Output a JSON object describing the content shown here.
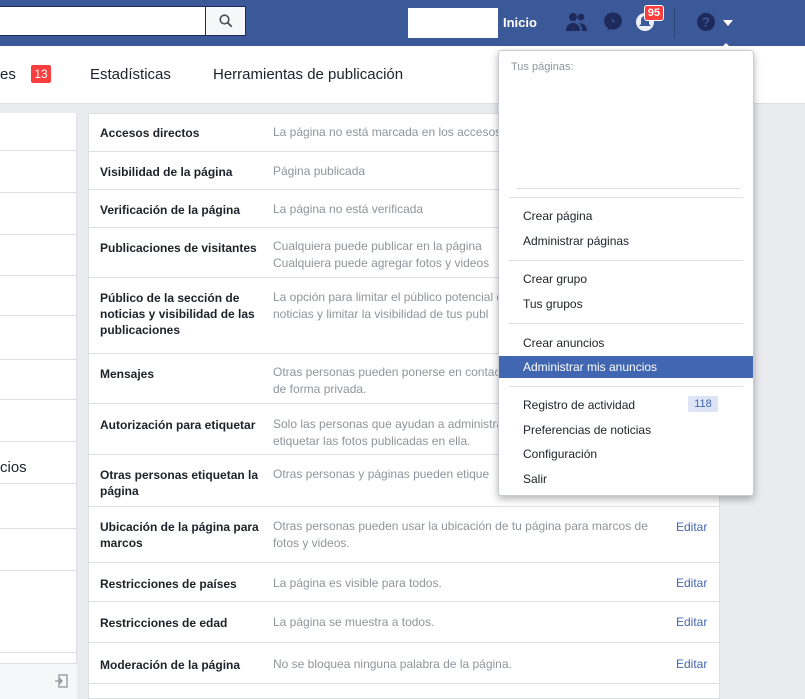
{
  "colors": {
    "topbar": "#3b5998",
    "link": "#4267b2",
    "badge": "#fa3e3e",
    "highlight": "#4267b2"
  },
  "topbar": {
    "inicio": "Inicio",
    "notifications_count": "95",
    "icons": [
      "search-icon",
      "friends-icon",
      "messenger-icon",
      "notifications-icon",
      "help-icon",
      "chevron-down-icon"
    ]
  },
  "tabs": {
    "partial_label": "es",
    "partial_badge": "13",
    "estadisticas": "Estadísticas",
    "herramientas": "Herramientas de publicación"
  },
  "sidebar": {
    "partial_text": "cios"
  },
  "settings": [
    {
      "label": "Accesos directos",
      "value": "La página no está marcada en los accesos",
      "edit": ""
    },
    {
      "label": "Visibilidad de la página",
      "value": "Página publicada",
      "edit": ""
    },
    {
      "label": "Verificación de la página",
      "value": "La página no está verificada",
      "edit": ""
    },
    {
      "label": "Publicaciones de visitantes",
      "value": "Cualquiera puede publicar en la página\nCualquiera puede agregar fotos y videos",
      "edit": ""
    },
    {
      "label": "Público de la sección de noticias y visibilidad de las publicaciones",
      "value": "La opción para limitar el público potencial de noticias y limitar la visibilidad de tus publ",
      "edit": ""
    },
    {
      "label": "Mensajes",
      "value": "Otras personas pueden ponerse en contacto de forma privada.",
      "edit": ""
    },
    {
      "label": "Autorización para etiquetar",
      "value": "Solo las personas que ayudan a administrar etiquetar las fotos publicadas en ella.",
      "edit": ""
    },
    {
      "label": "Otras personas etiquetan la página",
      "value": "Otras personas y páginas pueden etique",
      "edit": ""
    },
    {
      "label": "Ubicación de la página para marcos",
      "value": "Otras personas pueden usar la ubicación de tu página para marcos de fotos y videos.",
      "edit": "Editar"
    },
    {
      "label": "Restricciones de países",
      "value": "La página es visible para todos.",
      "edit": "Editar"
    },
    {
      "label": "Restricciones de edad",
      "value": "La página se muestra a todos.",
      "edit": "Editar"
    },
    {
      "label": "Moderación de la página",
      "value": "No se bloquea ninguna palabra de la página.",
      "edit": "Editar"
    }
  ],
  "dropdown": {
    "header": "Tus páginas:",
    "group1": [
      "Crear página",
      "Administrar páginas"
    ],
    "group2": [
      "Crear grupo",
      "Tus grupos"
    ],
    "group3": [
      "Crear anuncios",
      "Administrar mis anuncios"
    ],
    "group4": [
      "Registro de actividad",
      "Preferencias de noticias",
      "Configuración",
      "Salir"
    ],
    "activity_count": "118",
    "active_item": "Administrar mis anuncios"
  }
}
